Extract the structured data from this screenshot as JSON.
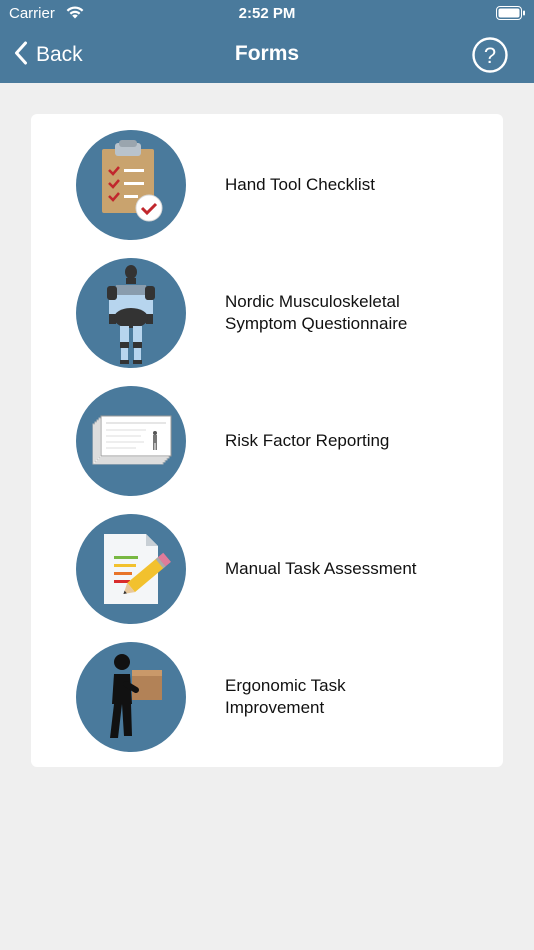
{
  "status_bar": {
    "carrier": "Carrier",
    "time": "2:52 PM"
  },
  "nav": {
    "back_label": "Back",
    "title": "Forms",
    "help_symbol": "?"
  },
  "forms": [
    {
      "label": "Hand Tool Checklist",
      "icon": "clipboard-checklist-icon"
    },
    {
      "label": "Nordic Musculoskeletal\nSymptom Questionnaire",
      "icon": "body-diagram-icon"
    },
    {
      "label": "Risk Factor Reporting",
      "icon": "report-pages-icon"
    },
    {
      "label": "Manual Task Assessment",
      "icon": "document-pencil-icon"
    },
    {
      "label": "Ergonomic Task\nImprovement",
      "icon": "person-carrying-box-icon"
    }
  ],
  "colors": {
    "header": "#4a7a9c",
    "background": "#efefef",
    "card": "#ffffff",
    "icon_circle": "#4a7a9c"
  }
}
